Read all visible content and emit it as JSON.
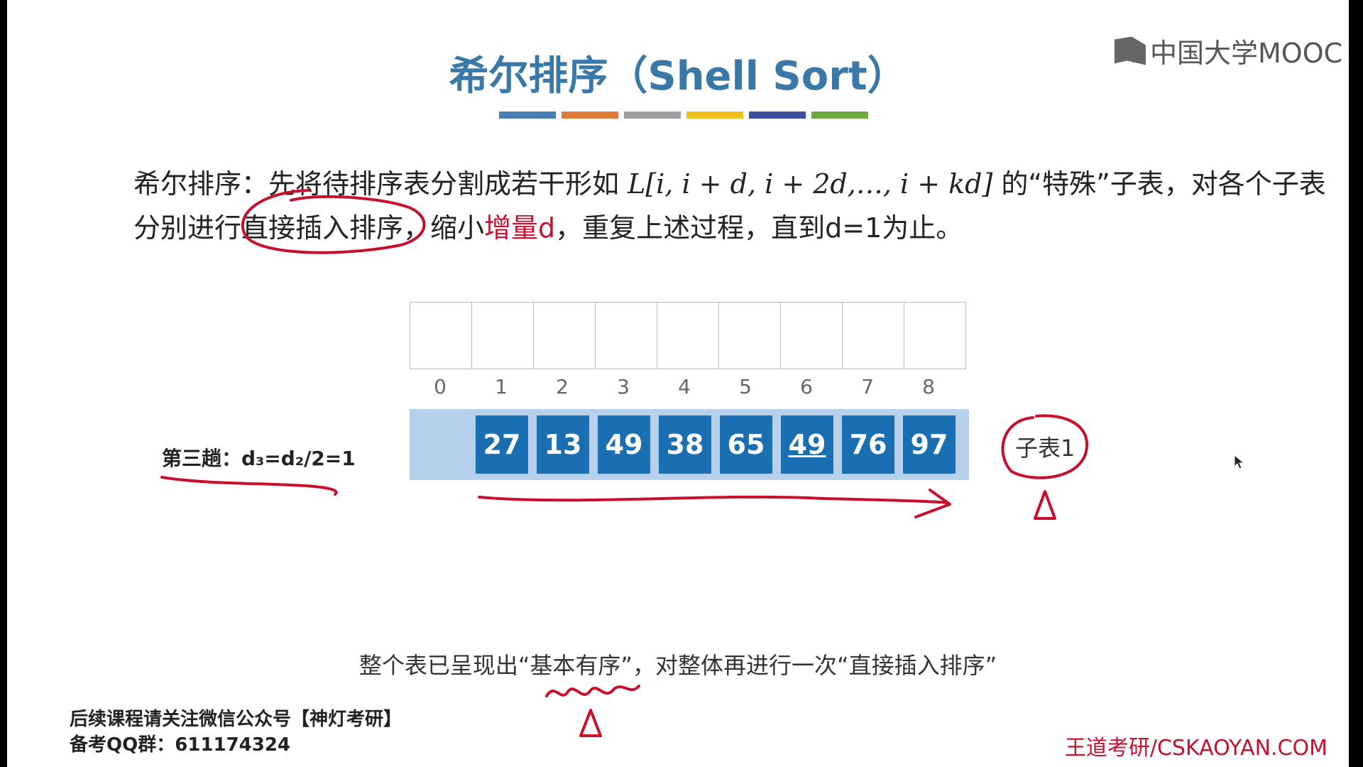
{
  "title": "希尔排序（Shell Sort）",
  "colorbar": [
    "#4a7fb5",
    "#e07b39",
    "#a0a0a0",
    "#f0c020",
    "#3a4fa0",
    "#6aaa40"
  ],
  "logo": {
    "text": "中国大学MOOC",
    "icon": "mooc-logo-icon"
  },
  "definition": {
    "line1_prefix": "希尔排序：先将待排序表分割成若干形如 ",
    "formula": "L[i, i + d, i + 2d,…, i + kd]",
    "line1_suffix": " 的“特殊”子表，对各个子表",
    "line2_a": "分别进行直接插入排序，缩小",
    "line2_highlight": "增量d",
    "line2_b": "，重复上述过程，直到d=1为止。"
  },
  "array": {
    "indices": [
      "0",
      "1",
      "2",
      "3",
      "4",
      "5",
      "6",
      "7",
      "8"
    ],
    "values": [
      "27",
      "13",
      "49",
      "38",
      "65",
      "49",
      "76",
      "97"
    ],
    "underlined_index": 5
  },
  "pass_label": "第三趟：d₃=d₂/2=1",
  "sublist_label": "子表1",
  "note": "整个表已呈现出“基本有序”，对整体再进行一次“直接插入排序”",
  "promo": {
    "line1": "后续课程请关注微信公众号【神灯考研】",
    "line2": "备考QQ群：611174324"
  },
  "site": "王道考研/CSKAOYAN.COM",
  "accent_colors": {
    "title": "#3a78a8",
    "cell": "#1a6fb3",
    "strip": "#b7d0ec",
    "ink": "#c8102e"
  }
}
